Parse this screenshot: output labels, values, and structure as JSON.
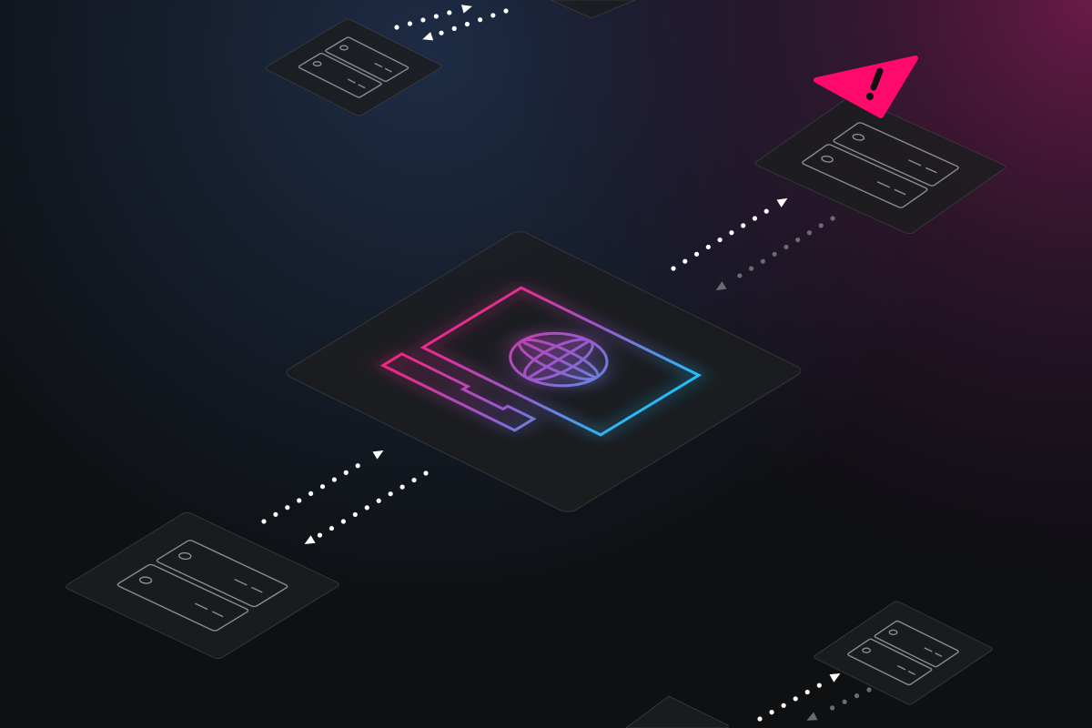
{
  "colors": {
    "background": "#0e1012",
    "glow_navy": "#1d2b44",
    "glow_magenta": "#5c1a44",
    "tile_fill": "#1c1d20",
    "tile_stroke": "#3a3c40",
    "gradient_start": "#ff1f7a",
    "gradient_end": "#19c8ff",
    "server_stroke": "#8a8c90",
    "dot_bright": "#ffffff",
    "dot_dim": "#6a6c70",
    "alert": "#ff0a6c"
  },
  "nodes": [
    {
      "id": "client",
      "icon": "monitor-globe-icon"
    },
    {
      "id": "server-top-left",
      "icon": "server-icon"
    },
    {
      "id": "server-top-right",
      "icon": "server-icon",
      "alert": "warning-icon"
    },
    {
      "id": "server-bottom-left",
      "icon": "server-icon"
    },
    {
      "id": "server-bottom-right",
      "icon": "server-icon"
    }
  ]
}
